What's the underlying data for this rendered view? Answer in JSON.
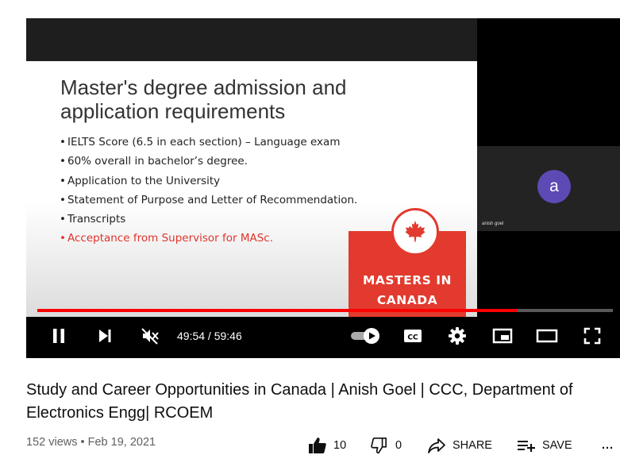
{
  "player": {
    "slide": {
      "title": "Master's degree admission and application requirements",
      "bullets": [
        "IELTS Score (6.5 in each section) – Language exam",
        "60% overall in bachelor’s degree.",
        "Application to the University",
        "Statement of Purpose and Letter of Recommendation.",
        "Transcripts",
        "Acceptance from Supervisor for MASc."
      ],
      "logo_line1": "MASTERS IN",
      "logo_line2": "CANADA"
    },
    "participant": {
      "avatar_letter": "a",
      "name": "anish goel"
    },
    "progress_fraction": 0.835,
    "time_current": "49:54",
    "time_separator": " / ",
    "time_total": "59:46",
    "autoplay_on": true,
    "icons": [
      "pause-icon",
      "next-icon",
      "mute-icon",
      "autoplay-toggle",
      "cc-icon",
      "settings-icon",
      "miniplayer-icon",
      "theater-icon",
      "fullscreen-icon"
    ]
  },
  "video": {
    "title": "Study and Career Opportunities in Canada | Anish Goel | CCC, Department of Electronics Engg| RCOEM",
    "views": "152 views",
    "separator": " • ",
    "date": "Feb 19, 2021"
  },
  "actions": {
    "like_count": "10",
    "dislike_count": "0",
    "share_label": "SHARE",
    "save_label": "SAVE",
    "more": "..."
  },
  "colors": {
    "progress": "#ff0000",
    "avatar": "#5e4ab5",
    "logo_red": "#e23a2e",
    "bullet_red": "#e0342b"
  }
}
